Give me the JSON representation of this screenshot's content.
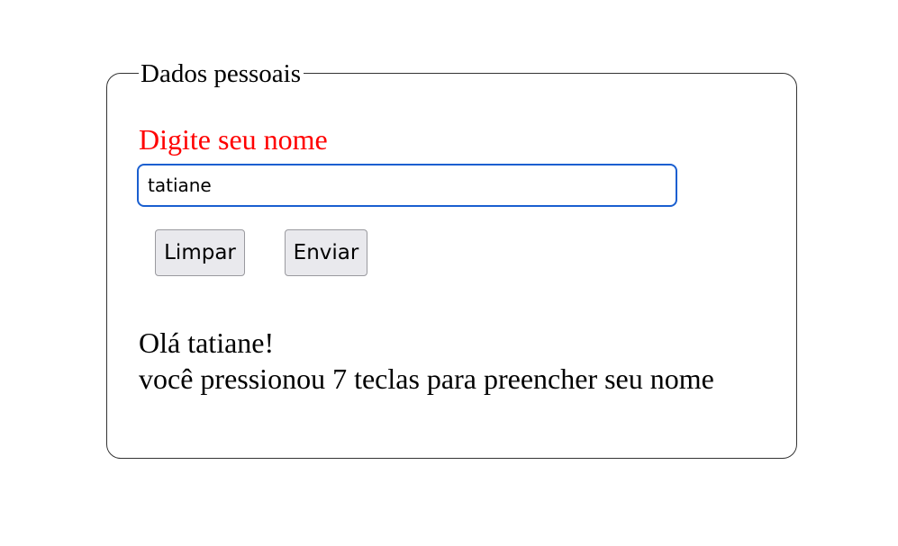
{
  "form": {
    "legend": "Dados pessoais",
    "name_label": "Digite seu nome",
    "name_value": "tatiane",
    "clear_label": "Limpar",
    "send_label": "Enviar",
    "label_color": "#ff0000",
    "input_focus_color": "#1a5fd0"
  },
  "result": {
    "greeting": "Olá tatiane!",
    "keycount": "você pressionou 7 teclas para preencher seu nome"
  }
}
